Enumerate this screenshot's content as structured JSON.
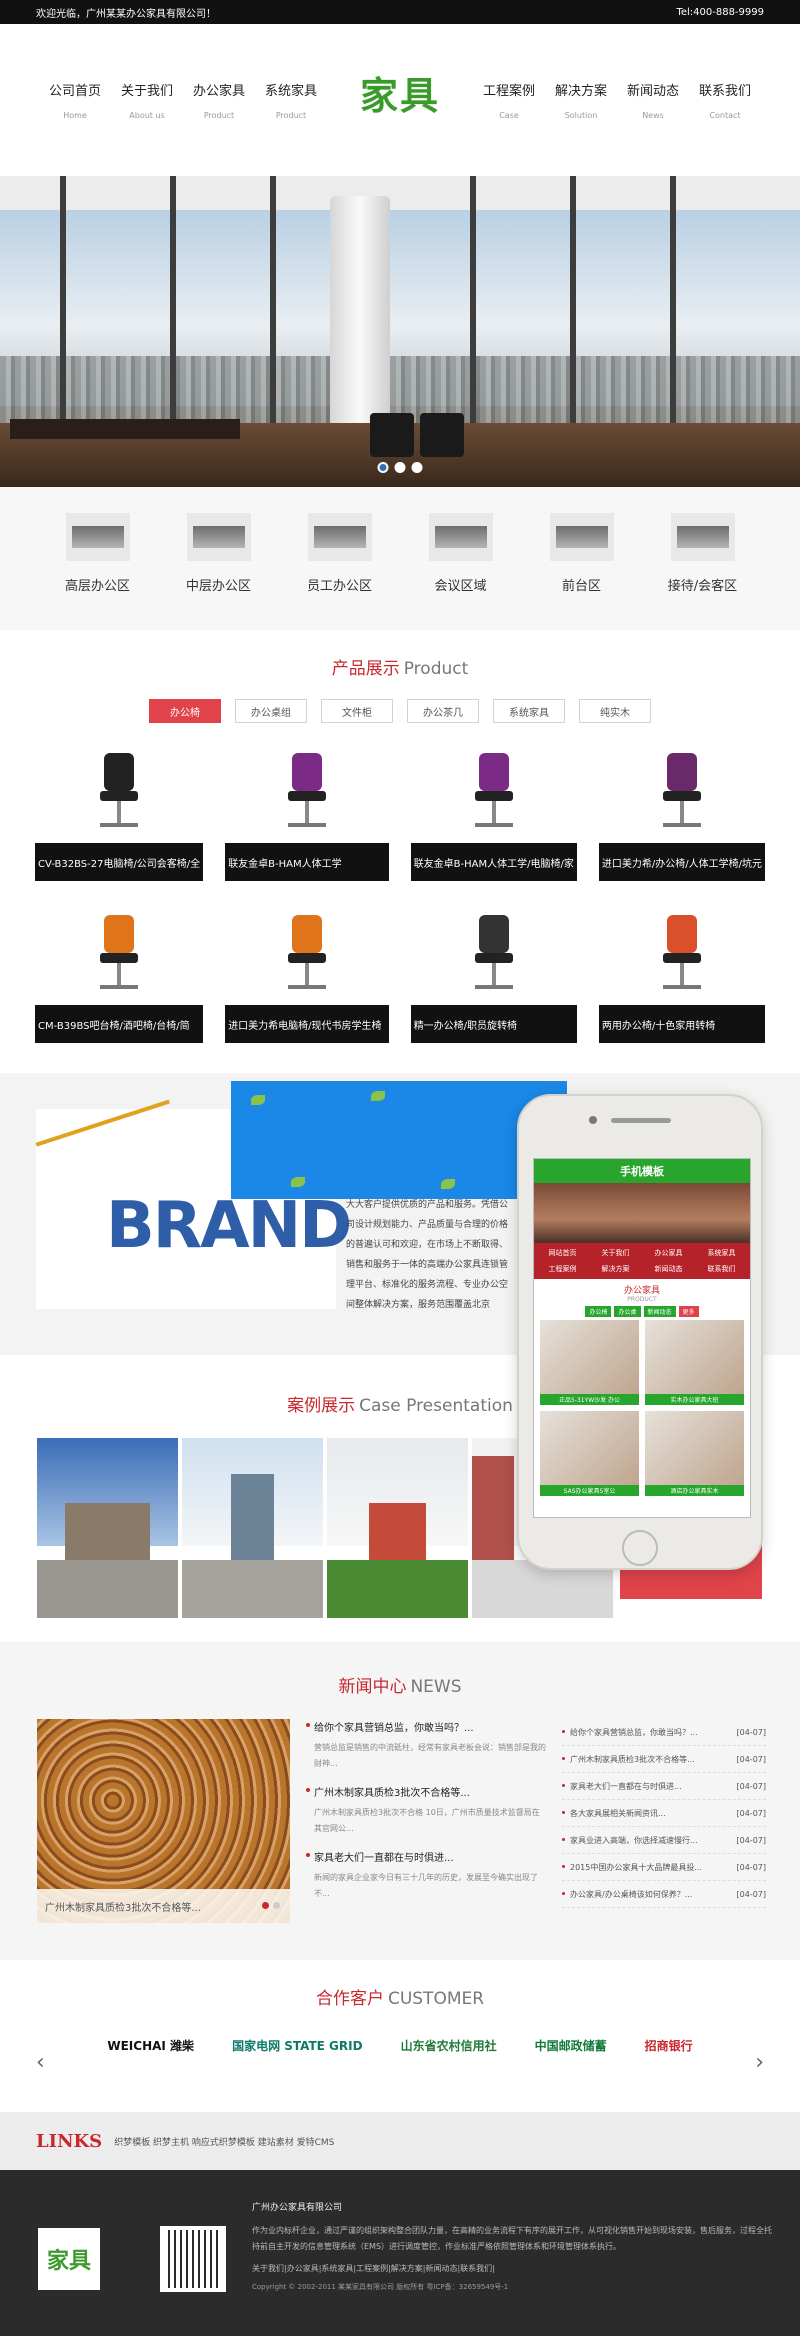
{
  "topbar": {
    "welcome": "欢迎光临，广州某某办公家具有限公司！",
    "tel": "Tel:400-888-9999"
  },
  "nav": {
    "left": [
      {
        "cn": "公司首页",
        "en": "Home"
      },
      {
        "cn": "关于我们",
        "en": "About us"
      },
      {
        "cn": "办公家具",
        "en": "Product"
      },
      {
        "cn": "系统家具",
        "en": "Product"
      }
    ],
    "logo": "家具",
    "right": [
      {
        "cn": "工程案例",
        "en": "Case"
      },
      {
        "cn": "解决方案",
        "en": "Solution"
      },
      {
        "cn": "新闻动态",
        "en": "News"
      },
      {
        "cn": "联系我们",
        "en": "Contact"
      }
    ]
  },
  "banner": {
    "active_slide": 1,
    "slides": 3
  },
  "areas": [
    "高层办公区",
    "中层办公区",
    "员工办公区",
    "会议区域",
    "前台区",
    "接待/会客区"
  ],
  "products": {
    "title_cn": "产品展示",
    "title_en": "Product",
    "tabs": [
      "办公椅",
      "办公桌组",
      "文件柜",
      "办公茶几",
      "系统家具",
      "纯实木"
    ],
    "active_tab": 0,
    "items": [
      {
        "name": "CV-B32BS-27电脑椅/公司会客椅/全",
        "color": "#222"
      },
      {
        "name": "联友金卓B-HAM人体工学",
        "color": "#7b2a86"
      },
      {
        "name": "联友金卓B-HAM人体工学/电脑椅/家",
        "color": "#7b2a86"
      },
      {
        "name": "进口美力希/办公椅/人体工学椅/坑元",
        "color": "#6a2a6a"
      },
      {
        "name": "CM-B39BS吧台椅/酒吧椅/台椅/简",
        "color": "#e0741a"
      },
      {
        "name": "进口美力希电脑椅/现代书房学生椅",
        "color": "#e0741a"
      },
      {
        "name": "精一办公椅/职员旋转椅",
        "color": "#333"
      },
      {
        "name": "两用办公椅/十色家用转椅",
        "color": "#d9502a"
      }
    ]
  },
  "about": {
    "brand_word": "BRAND",
    "text": "大大客户提供优质的产品和服务。凭借公司设计规划能力、产品质量与合理的价格的普遍认可和欢迎，在市场上不断取得、销售和服务于一体的高端办公家具连锁管理平台、标准化的服务流程、专业办公空间整体解决方案，服务范围覆盖北京"
  },
  "mobile": {
    "header": "手机模板",
    "nav": [
      "网站首页",
      "关于我们",
      "办公家具",
      "系统家具",
      "工程案例",
      "解决方案",
      "新闻动态",
      "联系我们"
    ],
    "title": "办公家具",
    "sub": "PRODUCT",
    "tabs": [
      "办公椅",
      "办公桌",
      "新闻动态",
      "更多"
    ],
    "cards": [
      "正品5-31YW沙发 办公",
      "实木办公家具大班",
      "SAS办公家具5室公",
      "酒店办公家具实木"
    ]
  },
  "cases": {
    "title_cn": "案例展示",
    "title_en": "Case Presentation"
  },
  "news": {
    "title_cn": "新闻中心",
    "title_en": "NEWS",
    "img_caption": "广州木制家具质检3批次不合格等...",
    "featured": [
      {
        "t": "给你个家具营销总监，你敢当吗？...",
        "d": "营销总监是销售的中流砥柱，经常有家具老板会说：销售部是我的财神..."
      },
      {
        "t": "广州木制家具质检3批次不合格等...",
        "d": "广州木制家具质检3批次不合格 10日，广州市质量技术监督局在其官网公..."
      },
      {
        "t": "家具老大们一直都在与时俱进...",
        "d": "新闻的家具企业家今日有三十几年的历史，发展至今确实出现了不..."
      }
    ],
    "list": [
      {
        "t": "给你个家具营销总监，你敢当吗？...",
        "date": "[04-07]"
      },
      {
        "t": "广州木制家具质检3批次不合格等...",
        "date": "[04-07]"
      },
      {
        "t": "家具老大们一直都在与时俱进...",
        "date": "[04-07]"
      },
      {
        "t": "各大家具展相关新闻资讯...",
        "date": "[04-07]"
      },
      {
        "t": "家具业进入高端，你选择减速慢行...",
        "date": "[04-07]"
      },
      {
        "t": "2015中国办公家具十大品牌最具投...",
        "date": "[04-07]"
      },
      {
        "t": "办公家具/办公桌椅该如何保养？...",
        "date": "[04-07]"
      }
    ]
  },
  "partners": {
    "title_cn": "合作客户",
    "title_en": "CUSTOMER",
    "items": [
      {
        "name": "WEICHAI 潍柴",
        "color": "#111"
      },
      {
        "name": "国家电网 STATE GRID",
        "color": "#0d7a6a"
      },
      {
        "name": "山东省农村信用社",
        "color": "#1f7a36"
      },
      {
        "name": "中国邮政储蓄",
        "color": "#117a3a"
      },
      {
        "name": "招商银行",
        "color": "#c8282e"
      }
    ]
  },
  "links": {
    "title": "LINKS",
    "items": "织梦模板 织梦主机 响应式织梦模板 建站素材 爱特CMS"
  },
  "footer": {
    "logo": "家具",
    "company": "广州办公家具有限公司",
    "desc": "作为业内标杆企业，通过严谨的组织架构整合团队力量，在高精的业务流程下有序的展开工作，从可视化销售开始到现场安装，售后服务，过程全托持前自主开发的信息管理系统（EMS）进行调度管控，作业标准严格依照管理体系和环境管理体系执行。",
    "links": "关于我们|办公家具|系统家具|工程案例|解决方案|新闻动态|联系我们|",
    "copyright": "Copyright © 2002-2011 某某家具有限公司 版权所有 粤ICP备：32659549号-1"
  }
}
